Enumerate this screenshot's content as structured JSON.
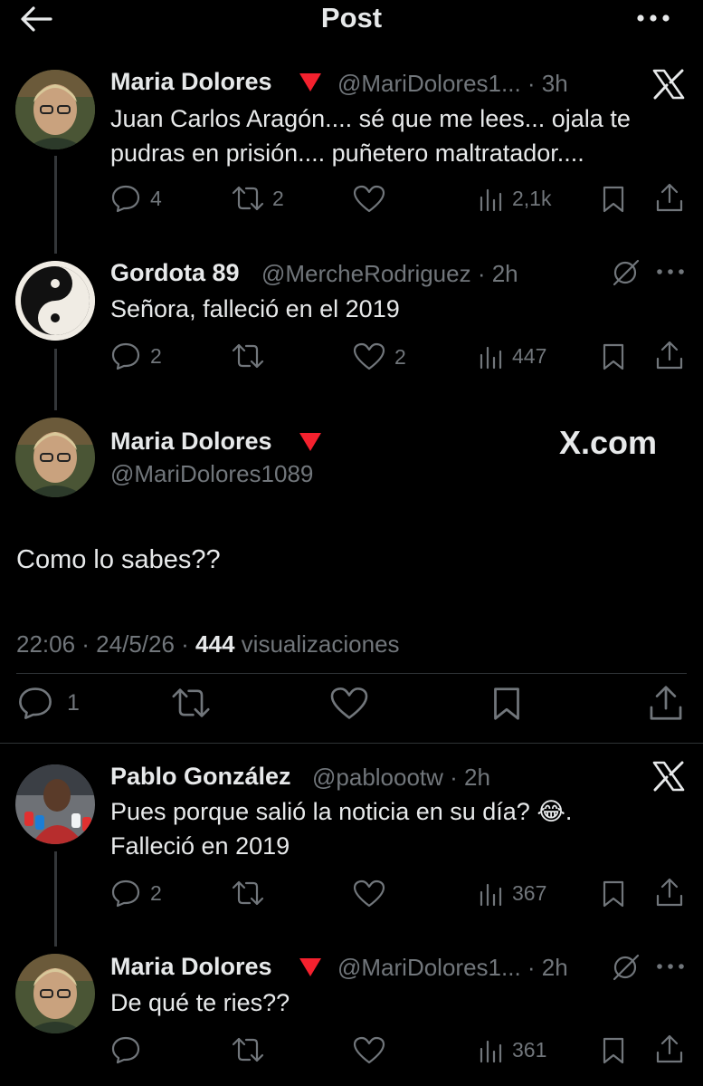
{
  "header": {
    "title": "Post"
  },
  "tweets": [
    {
      "name": "Maria Dolores",
      "handle": "@MariDolores1... · 3h",
      "line1": "Juan Carlos Aragón.... sé que me lees... ojala te",
      "line2": "pudras en prisión.... puñetero maltratador....",
      "replies": "4",
      "retweets": "2",
      "likes": "",
      "views": "2,1k"
    },
    {
      "name": "Gordota 89",
      "handle": "@MercheRodriguez · 2h",
      "line1": "Señora, falleció en el 2019",
      "replies": "2",
      "retweets": "",
      "likes": "2",
      "views": "447"
    },
    {
      "name": "Pablo González",
      "handle": "@pabloootw · 2h",
      "line1": "Pues porque salió la noticia en su día? 😂.",
      "line2": "Falleció en 2019",
      "replies": "2",
      "retweets": "",
      "likes": "",
      "views": "367"
    },
    {
      "name": "Maria Dolores",
      "handle": "@MariDolores1... · 2h",
      "line1": "De qué te ries??",
      "replies": "",
      "retweets": "",
      "likes": "",
      "views": "361"
    }
  ],
  "main": {
    "name": "Maria Dolores",
    "handle": "@MariDolores1089",
    "watermark": "X.com",
    "text": "Como lo sabes??",
    "time": "22:06 · 24/5/26 ·",
    "views_count": "444",
    "views_label": "visualizaciones",
    "replies": "1"
  }
}
